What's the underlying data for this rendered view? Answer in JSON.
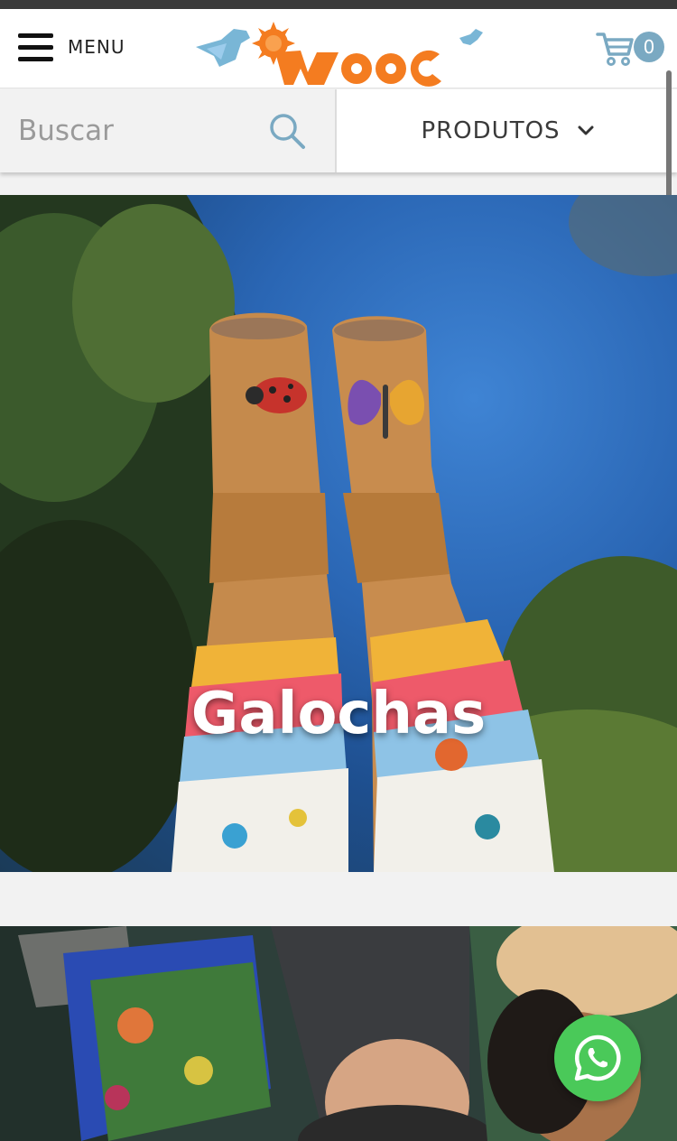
{
  "header": {
    "menu_label": "MENU",
    "cart_count": "0"
  },
  "search": {
    "placeholder": "Buscar"
  },
  "nav": {
    "products_label": "PRODUTOS"
  },
  "hero": {
    "title": "Galochas"
  },
  "colors": {
    "logo_orange": "#f47c20",
    "logo_blue": "#79b6d6",
    "cart_blue": "#7aa9c2",
    "whatsapp_green": "#4ac959"
  },
  "icons": [
    "hamburger-icon",
    "cart-icon",
    "search-icon",
    "chevron-down-icon",
    "whatsapp-icon"
  ]
}
